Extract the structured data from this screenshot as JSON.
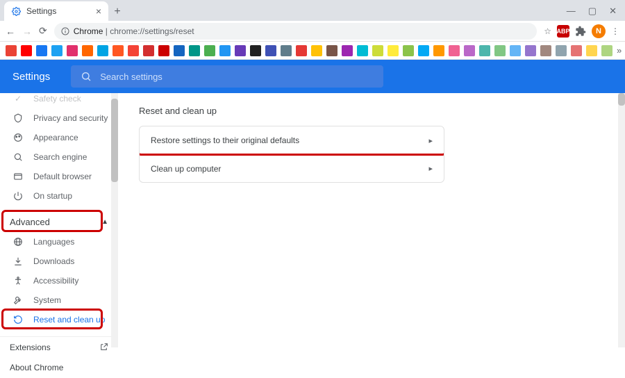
{
  "tab": {
    "title": "Settings"
  },
  "url": {
    "host": "Chrome",
    "path": "chrome://settings/reset"
  },
  "avatar_initial": "N",
  "ext_abp": "ABP",
  "header": {
    "title": "Settings"
  },
  "search": {
    "placeholder": "Search settings"
  },
  "sidebar": {
    "items_top": [
      {
        "label": "Safety check"
      },
      {
        "label": "Privacy and security"
      },
      {
        "label": "Appearance"
      },
      {
        "label": "Search engine"
      },
      {
        "label": "Default browser"
      },
      {
        "label": "On startup"
      }
    ],
    "advanced_label": "Advanced",
    "items_adv": [
      {
        "label": "Languages"
      },
      {
        "label": "Downloads"
      },
      {
        "label": "Accessibility"
      },
      {
        "label": "System"
      },
      {
        "label": "Reset and clean up"
      }
    ],
    "extensions": "Extensions",
    "about": "About Chrome"
  },
  "main": {
    "section_title": "Reset and clean up",
    "rows": [
      {
        "label": "Restore settings to their original defaults"
      },
      {
        "label": "Clean up computer"
      }
    ]
  },
  "bookmarks_colors": [
    "#ea4335",
    "#ff0000",
    "#1877f2",
    "#1da1f2",
    "#e1306c",
    "#ff6600",
    "#00a4e4",
    "#ff5722",
    "#f44336",
    "#d32f2f",
    "#cc0000",
    "#1565c0",
    "#009688",
    "#4caf50",
    "#2196f3",
    "#673ab7",
    "#212121",
    "#3f51b5",
    "#607d8b",
    "#e53935",
    "#ffc107",
    "#795548",
    "#9c27b0",
    "#00bcd4",
    "#cddc39",
    "#ffeb3b",
    "#8bc34a",
    "#03a9f4",
    "#ff9800",
    "#f06292",
    "#ba68c8",
    "#4db6ac",
    "#81c784",
    "#64b5f6",
    "#9575cd",
    "#a1887f",
    "#90a4ae",
    "#e57373",
    "#ffd54f",
    "#aed581"
  ]
}
